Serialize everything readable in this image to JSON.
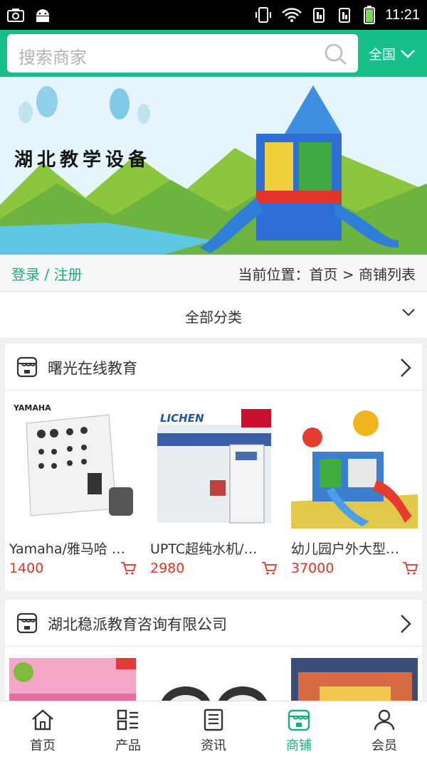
{
  "status_bar": {
    "time": "11:21"
  },
  "search": {
    "placeholder": "搜索商家",
    "region": "全国"
  },
  "banner": {
    "title": "湖北教学设备"
  },
  "user_bar": {
    "login": "登录",
    "separator": " / ",
    "register": "注册",
    "breadcrumb": "当前位置：首页 > 商铺列表"
  },
  "category": {
    "label": "全部分类"
  },
  "shops": [
    {
      "name": "曙光在线教育",
      "products": [
        {
          "name": "Yamaha/雅马哈 …",
          "price": "1400",
          "img_text": "YAMAHA"
        },
        {
          "name": "UPTC超纯水机/…",
          "price": "2980",
          "img_text": "LICHEN"
        },
        {
          "name": "幼儿园户外大型…",
          "price": "37000",
          "img_text": ""
        }
      ]
    },
    {
      "name": "湖北稳派教育咨询有限公司",
      "products": [
        {
          "name": "",
          "price": ""
        },
        {
          "name": "",
          "price": ""
        },
        {
          "name": "",
          "price": ""
        }
      ]
    }
  ],
  "tabs": [
    {
      "label": "首页",
      "icon": "home-icon"
    },
    {
      "label": "产品",
      "icon": "grid-icon"
    },
    {
      "label": "资讯",
      "icon": "news-icon"
    },
    {
      "label": "商铺",
      "icon": "shop-icon",
      "active": true
    },
    {
      "label": "会员",
      "icon": "user-icon"
    }
  ],
  "colors": {
    "brand": "#17c08a",
    "price": "#e6321e",
    "active_tab": "#17b07d"
  }
}
